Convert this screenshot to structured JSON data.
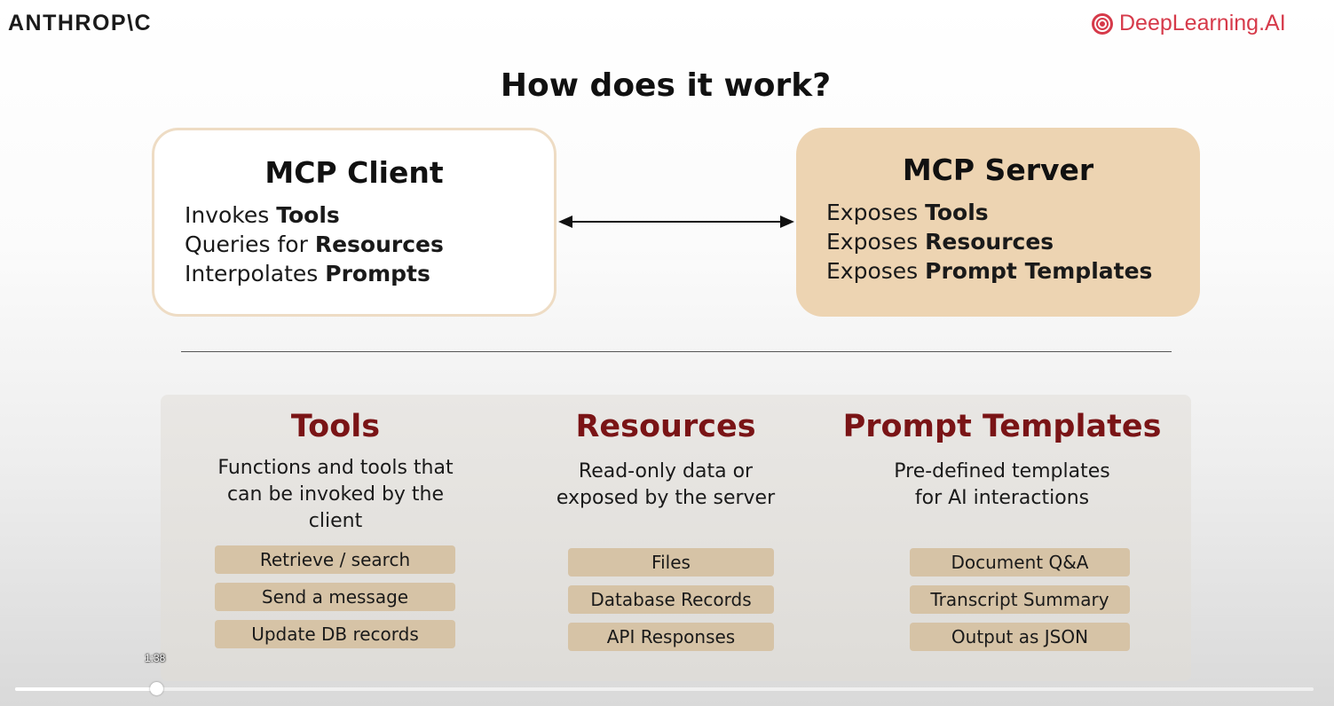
{
  "header": {
    "left_brand": "ANTHROP\\C",
    "right_brand": "DeepLearning.AI",
    "right_brand_color": "#d63a4a"
  },
  "slide": {
    "title": "How does it work?",
    "client": {
      "title": "MCP Client",
      "lines": [
        {
          "prefix": "Invokes ",
          "bold": "Tools"
        },
        {
          "prefix": "Queries for ",
          "bold": "Resources"
        },
        {
          "prefix": "Interpolates ",
          "bold": "Prompts"
        }
      ]
    },
    "server": {
      "title": "MCP Server",
      "lines": [
        {
          "prefix": "Exposes ",
          "bold": "Tools"
        },
        {
          "prefix": "Exposes ",
          "bold": "Resources"
        },
        {
          "prefix": "Exposes ",
          "bold": "Prompt Templates"
        }
      ]
    },
    "columns": [
      {
        "title": "Tools",
        "desc": [
          "Functions and tools that",
          "can be invoked by the",
          "client"
        ],
        "items": [
          "Retrieve / search",
          "Send a message",
          "Update DB records"
        ]
      },
      {
        "title": "Resources",
        "desc": [
          "Read-only data or",
          "exposed by the server"
        ],
        "items": [
          "Files",
          "Database Records",
          "API Responses"
        ]
      },
      {
        "title": "Prompt Templates",
        "desc": [
          "Pre-defined templates",
          "for AI interactions"
        ],
        "items": [
          "Document Q&A",
          "Transcript Summary",
          "Output as JSON"
        ]
      }
    ],
    "colors": {
      "column_title": "#7a1416",
      "server_fill": "#edd4b2",
      "client_border": "#eedcc4",
      "pill_fill": "#d6c3a6"
    }
  },
  "video": {
    "time": "1:38",
    "progress": 0.109
  }
}
